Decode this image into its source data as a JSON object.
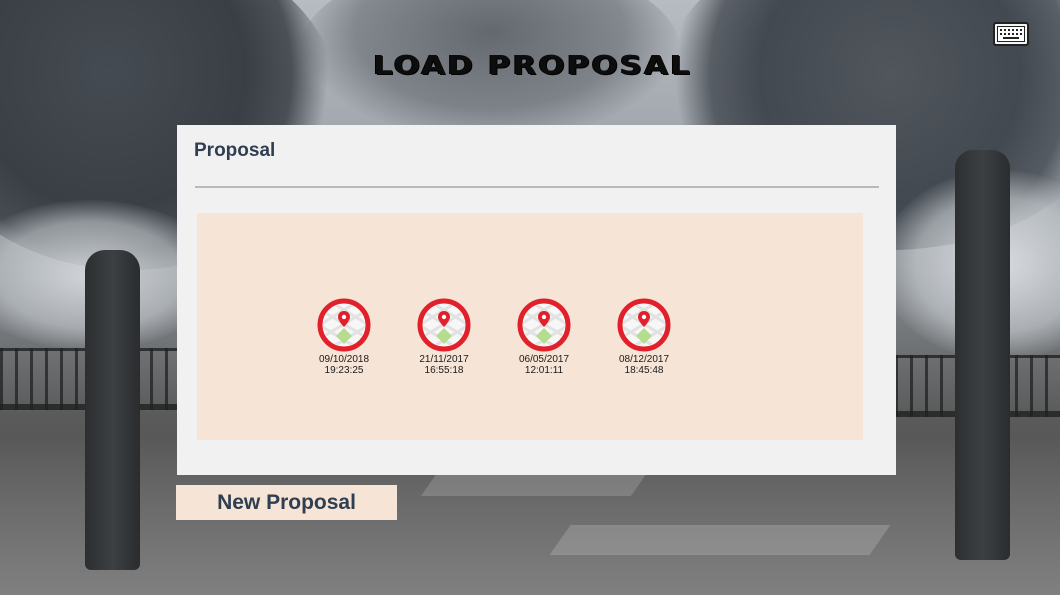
{
  "header": {
    "title": "LOAD PROPOSAL",
    "keyboard_icon": "keyboard-icon"
  },
  "panel": {
    "title": "Proposal",
    "proposals": [
      {
        "date": "09/10/2018",
        "time": "19:23:25",
        "icon": "map-pin-icon"
      },
      {
        "date": "21/11/2017",
        "time": "16:55:18",
        "icon": "map-pin-icon"
      },
      {
        "date": "06/05/2017",
        "time": "12:01:11",
        "icon": "map-pin-icon"
      },
      {
        "date": "08/12/2017",
        "time": "18:45:48",
        "icon": "map-pin-icon"
      }
    ]
  },
  "footer": {
    "new_button_label": "New Proposal"
  },
  "colors": {
    "accent": "#f6e4d6",
    "panel": "#f1f1f1",
    "heading_text": "#2f3f52",
    "pin_ring": "#e0212b"
  }
}
